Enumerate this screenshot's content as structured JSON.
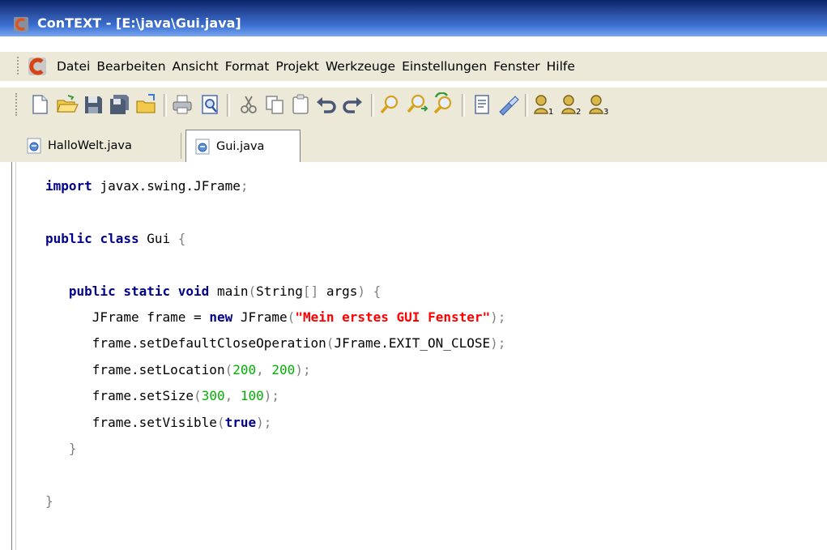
{
  "window": {
    "title": "ConTEXT - [E:\\java\\Gui.java]"
  },
  "menu": {
    "items": [
      "Datei",
      "Bearbeiten",
      "Ansicht",
      "Format",
      "Projekt",
      "Werkzeuge",
      "Einstellungen",
      "Fenster",
      "Hilfe"
    ]
  },
  "toolbar": {
    "icons": [
      "new-file-icon",
      "open-file-icon",
      "save-icon",
      "save-all-icon",
      "open-folder-icon",
      "print-icon",
      "print-preview-icon",
      "cut-icon",
      "copy-icon",
      "paste-icon",
      "undo-icon",
      "redo-icon",
      "find-icon",
      "find-next-icon",
      "replace-icon",
      "document-properties-icon",
      "highlighter-icon",
      "user-command-1-icon",
      "user-command-2-icon",
      "user-command-3-icon"
    ]
  },
  "tabs": [
    {
      "label": "HalloWelt.java",
      "active": false
    },
    {
      "label": "Gui.java",
      "active": true
    }
  ],
  "editor": {
    "lines": [
      "import javax.swing.JFrame;",
      "",
      "public class Gui {",
      "",
      "   public static void main(String[] args) {",
      "      JFrame frame = new JFrame(\"Mein erstes GUI Fenster\");",
      "      frame.setDefaultCloseOperation(JFrame.EXIT_ON_CLOSE);",
      "      frame.setLocation(200, 200);",
      "      frame.setSize(300, 100);",
      "      frame.setVisible(true);",
      "   }",
      "",
      "}"
    ]
  },
  "colors": {
    "keyword": "#00008b",
    "string": "#ff0000",
    "number": "#00b000",
    "punctuation": "#7f7f7f",
    "titlebar": "#0a246a"
  }
}
